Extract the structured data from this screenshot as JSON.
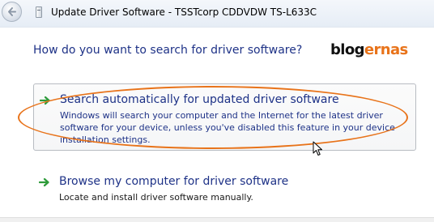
{
  "window": {
    "title": "Update Driver Software - TSSTcorp CDDVDW TS-L633C",
    "back_icon": "back-arrow-icon",
    "device_icon": "optical-drive-icon"
  },
  "main": {
    "heading": "How do you want to search for driver software?"
  },
  "logo": {
    "part1": "blog",
    "part2": "ernas",
    "colors": {
      "part1": "#111111",
      "part2": "#e8731a"
    }
  },
  "options": [
    {
      "icon": "green-arrow-icon",
      "title": "Search automatically for updated driver software",
      "description": "Windows will search your computer and the Internet for the latest driver software for your device, unless you've disabled this feature in your device installation settings."
    },
    {
      "icon": "green-arrow-icon",
      "title": "Browse my computer for driver software",
      "description": "Locate and install driver software manually."
    }
  ],
  "colors": {
    "link_blue": "#1e3287",
    "annotation_orange": "#e8731a",
    "arrow_green": "#2e9b3a"
  }
}
